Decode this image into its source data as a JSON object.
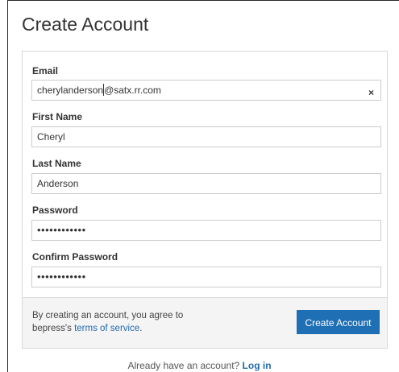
{
  "page": {
    "title": "Create Account"
  },
  "form": {
    "email": {
      "label": "Email",
      "value_before_caret": "cherylanderson",
      "value_after_caret": "@satx.rr.com",
      "clear_icon": "×"
    },
    "first_name": {
      "label": "First Name",
      "value": "Cheryl"
    },
    "last_name": {
      "label": "Last Name",
      "value": "Anderson"
    },
    "password": {
      "label": "Password",
      "masked_value": "••••••••••••"
    },
    "confirm_password": {
      "label": "Confirm Password",
      "masked_value": "••••••••••••"
    }
  },
  "footer": {
    "terms_prefix": "By creating an account, you agree to bepress's ",
    "terms_link": "terms of service",
    "terms_suffix": ".",
    "create_button": "Create Account"
  },
  "login": {
    "prompt": "Already have an account? ",
    "link": "Log in"
  },
  "colors": {
    "accent": "#1f6fb5",
    "link": "#1f6bb0",
    "footer_bg": "#f4f4f4"
  },
  "icons": {
    "clear": "close-icon"
  }
}
